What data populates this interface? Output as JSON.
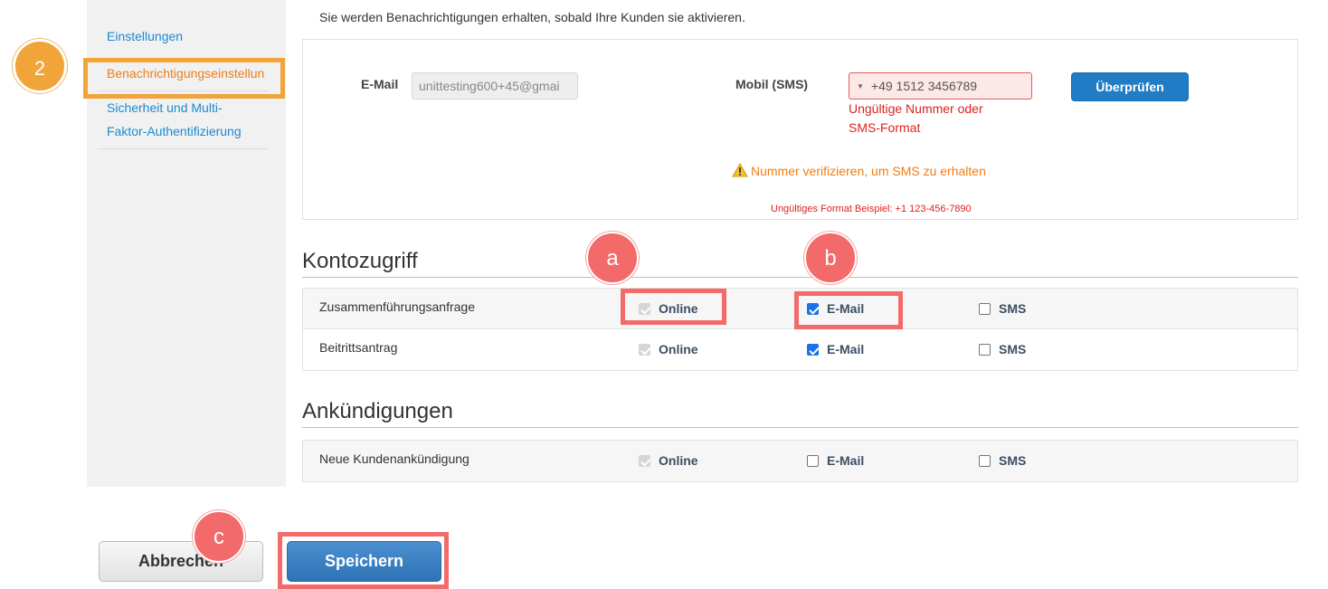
{
  "sidebar": {
    "items": [
      {
        "label": "Einstellungen"
      },
      {
        "label": "Benachrichtigungseinstellun"
      },
      {
        "label_line1": "Sicherheit und Multi-",
        "label_line2": "Faktor-Authentifizierung"
      }
    ]
  },
  "annotations": {
    "step": "2",
    "a": "a",
    "b": "b",
    "c": "c"
  },
  "intro_text": "Sie werden Benachrichtigungen erhalten, sobald Ihre Kunden sie aktivieren.",
  "contact": {
    "email_label": "E-Mail",
    "email_value": "unittesting600+45@gmai",
    "sms_label": "Mobil (SMS)",
    "sms_value": "+49 1512 3456789",
    "sms_flag_icon": "dropdown-caret-icon",
    "sms_error_line1": "Ungültige Nummer oder",
    "sms_error_line2": "SMS-Format",
    "verify_label": "Überprüfen",
    "warning_icon": "warning-icon",
    "warning_text": "Nummer verifizieren, um SMS zu erhalten",
    "format_hint": "Ungültiges Format Beispiel: +1 123-456-7890"
  },
  "sections": {
    "account_access": {
      "title": "Kontozugriff",
      "rows": [
        {
          "label": "Zusammenführungsanfrage",
          "online": "Online",
          "email": "E-Mail",
          "sms": "SMS",
          "online_checked": true,
          "email_checked": true,
          "sms_checked": false
        },
        {
          "label": "Beitrittsantrag",
          "online": "Online",
          "email": "E-Mail",
          "sms": "SMS",
          "online_checked": true,
          "email_checked": true,
          "sms_checked": false
        }
      ]
    },
    "announcements": {
      "title": "Ankündigungen",
      "rows": [
        {
          "label": "Neue Kundenankündigung",
          "online": "Online",
          "email": "E-Mail",
          "sms": "SMS",
          "online_checked": true,
          "email_checked": false,
          "sms_checked": false
        }
      ]
    }
  },
  "footer": {
    "cancel_label": "Abbrechen",
    "save_label": "Speichern"
  },
  "colors": {
    "link": "#1b8ad0",
    "active_link": "#ef7d15",
    "error": "#e02020",
    "primary_button": "#1f7cc5",
    "annotation_orange": "#f0a43a",
    "annotation_red": "#f26a6a"
  }
}
